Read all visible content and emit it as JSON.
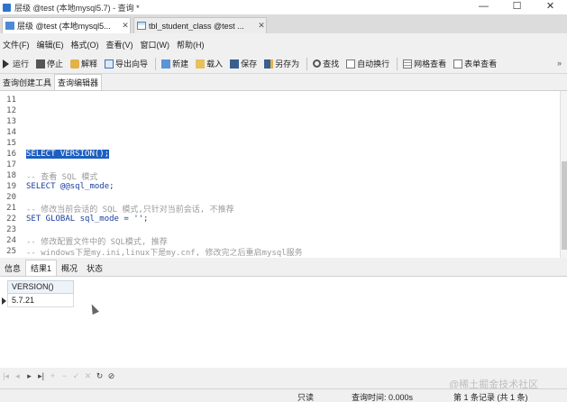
{
  "window": {
    "title": "层级 @test (本地mysql5.7) - 查询 *",
    "controls": [
      "—",
      "☐",
      "✕"
    ]
  },
  "doc_tabs": [
    {
      "label": "层级 @test (本地mysql5...",
      "close": "✕"
    },
    {
      "label": "tbl_student_class @test ...",
      "close": "✕"
    }
  ],
  "menu": [
    "文件(F)",
    "编辑(E)",
    "格式(O)",
    "查看(V)",
    "窗口(W)",
    "帮助(H)"
  ],
  "toolbar": {
    "run": "运行",
    "stop": "停止",
    "explain": "解释",
    "export_wizard": "导出向导",
    "new": "新建",
    "load": "载入",
    "save": "保存",
    "save_as": "另存为",
    "find": "查找",
    "word_wrap": "自动换行",
    "grid_view": "网格查看",
    "form_view": "表单查看",
    "more": "»"
  },
  "editor_tabs": {
    "builder": "查询创建工具",
    "editor": "查询编辑器"
  },
  "editor": {
    "lines": [
      {
        "n": "11",
        "text": "",
        "style": ""
      },
      {
        "n": "12",
        "text": "",
        "style": ""
      },
      {
        "n": "13",
        "text": "",
        "style": ""
      },
      {
        "n": "14",
        "text": "",
        "style": ""
      },
      {
        "n": "15",
        "text": "",
        "style": ""
      },
      {
        "n": "16",
        "text": "SELECT VERSION();",
        "style": "sel"
      },
      {
        "n": "17",
        "text": "",
        "style": ""
      },
      {
        "n": "18",
        "text": "-- 查看 SQL 模式",
        "style": "cm"
      },
      {
        "n": "19",
        "text": "SELECT @@sql_mode;",
        "style": "kw"
      },
      {
        "n": "20",
        "text": "",
        "style": ""
      },
      {
        "n": "21",
        "text": "-- 修改当前会话的 SQL 模式,只针对当前会话, 不推荐",
        "style": "cm"
      },
      {
        "n": "22",
        "text": "SET GLOBAL sql_mode = '';",
        "style": "kw"
      },
      {
        "n": "23",
        "text": "",
        "style": ""
      },
      {
        "n": "24",
        "text": "-- 修改配置文件中的 SQL模式, 推荐",
        "style": "cm"
      },
      {
        "n": "25",
        "text": "-- windows下是my.ini,linux下是my.cnf, 修改完之后重启mysql服务",
        "style": "cm"
      }
    ]
  },
  "result_tabs": [
    "信息",
    "结果1",
    "概况",
    "状态"
  ],
  "result": {
    "column": "VERSION()",
    "value": "5.7.21"
  },
  "nav_buttons": [
    "|◂",
    "◂",
    "▸",
    "▸|",
    "+",
    "−",
    "✓",
    "✕",
    "↻",
    "⊘"
  ],
  "status": {
    "read_only": "只读",
    "query_time": "查询时间: 0.000s",
    "records": "第 1 条记录 (共 1 条)"
  },
  "watermark": "@稀土掘金技术社区"
}
